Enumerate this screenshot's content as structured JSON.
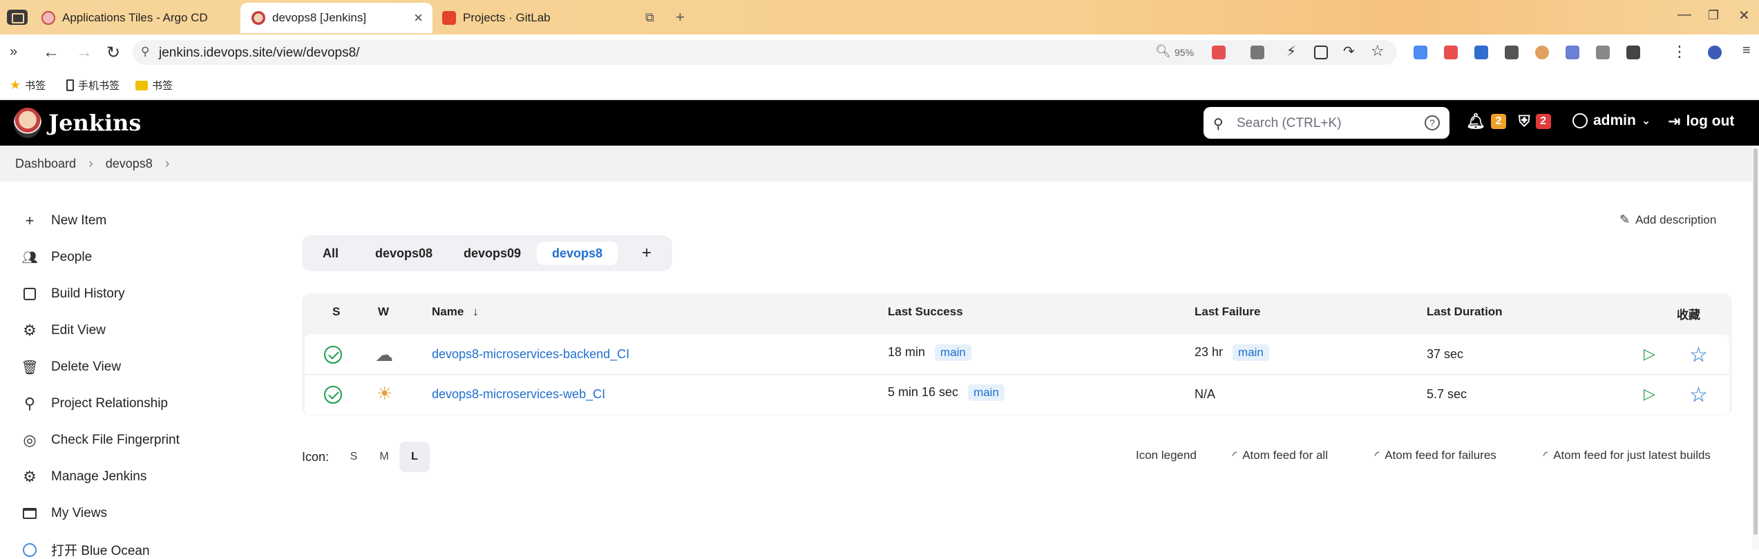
{
  "browser": {
    "tabs": [
      {
        "title": "Applications Tiles - Argo CD"
      },
      {
        "title": "devops8 [Jenkins]"
      },
      {
        "title": "Projects · GitLab"
      }
    ],
    "url": "jenkins.idevops.site/view/devops8/",
    "zoom": "95%",
    "bookmarks": [
      "书签",
      "手机书签",
      "书签"
    ]
  },
  "header": {
    "logo_text": "Jenkins",
    "search_placeholder": "Search (CTRL+K)",
    "notifications_count": "2",
    "security_count": "2",
    "user": "admin",
    "logout": "log out"
  },
  "breadcrumb": [
    "Dashboard",
    "devops8"
  ],
  "sidebar": {
    "items": [
      {
        "label": "New Item",
        "icon": "plus-icon"
      },
      {
        "label": "People",
        "icon": "people-icon"
      },
      {
        "label": "Build History",
        "icon": "history-icon"
      },
      {
        "label": "Edit View",
        "icon": "gear-icon"
      },
      {
        "label": "Delete View",
        "icon": "trash-icon"
      },
      {
        "label": "Project Relationship",
        "icon": "search-icon"
      },
      {
        "label": "Check File Fingerprint",
        "icon": "fingerprint-icon"
      },
      {
        "label": "Manage Jenkins",
        "icon": "gear-icon"
      },
      {
        "label": "My Views",
        "icon": "monitor-icon"
      },
      {
        "label": "打开 Blue Ocean",
        "icon": "blue-ocean-icon"
      }
    ]
  },
  "main": {
    "add_description": "Add description",
    "view_tabs": [
      "All",
      "devops08",
      "devops09",
      "devops8"
    ],
    "active_view": "devops8",
    "columns": {
      "s": "S",
      "w": "W",
      "name": "Name",
      "sort_arrow": "↓",
      "last_success": "Last Success",
      "last_failure": "Last Failure",
      "last_duration": "Last Duration",
      "fav": "收藏"
    },
    "jobs": [
      {
        "name": "devops8-microservices-backend_CI",
        "last_success": "18 min",
        "success_branch": "main",
        "last_failure": "23 hr",
        "failure_branch": "main",
        "last_duration": "37 sec",
        "weather": "cloudy"
      },
      {
        "name": "devops8-microservices-web_CI",
        "last_success": "5 min 16 sec",
        "success_branch": "main",
        "last_failure": "N/A",
        "failure_branch": "",
        "last_duration": "5.7 sec",
        "weather": "sunny"
      }
    ],
    "icon_label": "Icon:",
    "icon_sizes": [
      "S",
      "M",
      "L"
    ],
    "icon_size_active": "L",
    "footer_links": [
      "Icon legend",
      "Atom feed for all",
      "Atom feed for failures",
      "Atom feed for just latest builds"
    ]
  },
  "colors": {
    "accent": "#1f6fd0",
    "success": "#1d9e4a",
    "notify_badge": "#f0a02a",
    "security_badge": "#e03b3b"
  }
}
